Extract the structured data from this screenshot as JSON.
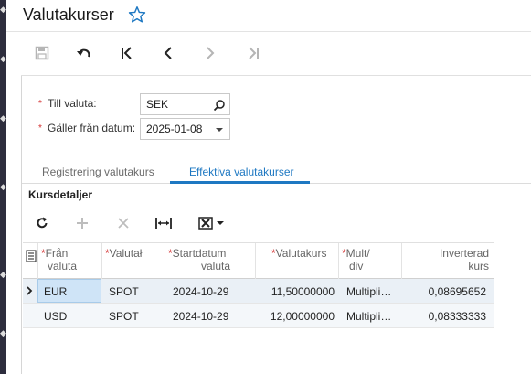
{
  "page": {
    "title": "Valutakurser"
  },
  "toolbar": {
    "buttons": [
      "save-icon",
      "undo-icon",
      "first-record-icon",
      "previous-icon",
      "next-icon",
      "last-record-icon"
    ]
  },
  "form": {
    "till_valuta": {
      "label": "Till valuta:",
      "value": "SEK"
    },
    "galler_fran": {
      "label": "Gäller från datum:",
      "value": "2025-01-08"
    }
  },
  "tabs": [
    {
      "label": "Registrering valutakurs",
      "active": false
    },
    {
      "label": "Effektiva valutakurser",
      "active": true
    }
  ],
  "section": {
    "title": "Kursdetaljer"
  },
  "grid": {
    "columns": [
      {
        "line1": "Från",
        "line2": "valuta",
        "required": true
      },
      {
        "line1": "Valutał",
        "line2": "",
        "required": true
      },
      {
        "line1": "Startdatum",
        "line2": "valuta",
        "required": true
      },
      {
        "line1": "Valutakurs",
        "line2": "",
        "required": true
      },
      {
        "line1": "Mult/",
        "line2": "div",
        "required": true
      },
      {
        "line1": "Inverterad",
        "line2": "kurs",
        "required": false
      }
    ],
    "rows": [
      {
        "from": "EUR",
        "type": "SPOT",
        "start": "2024-10-29",
        "rate": "11,50000000",
        "mult": "Multipli…",
        "inverted": "0,08695652"
      },
      {
        "from": "USD",
        "type": "SPOT",
        "start": "2024-10-29",
        "rate": "12,00000000",
        "mult": "Multipli…",
        "inverted": "0,08333333"
      }
    ]
  },
  "colors": {
    "accent": "#1e78c2",
    "required": "#d32f2f",
    "selected": "#cfe4f7"
  }
}
